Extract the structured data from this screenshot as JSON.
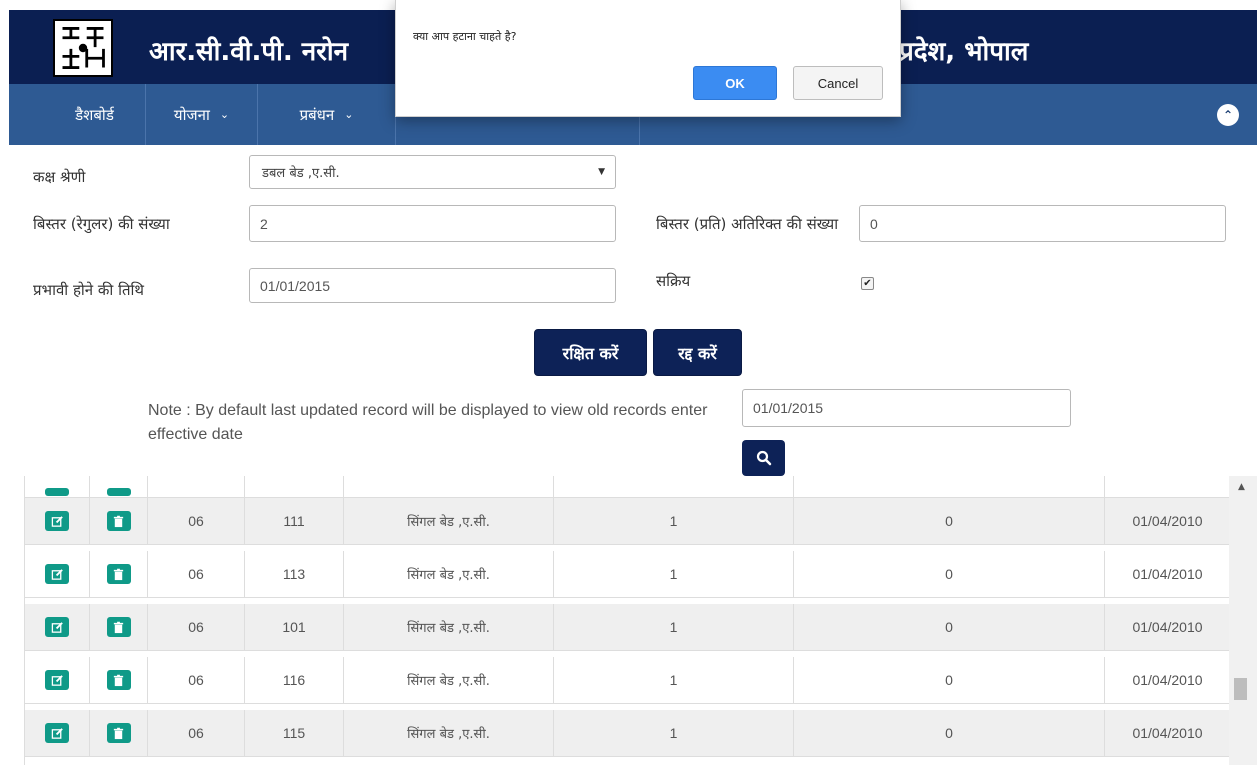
{
  "header": {
    "title_left": "आर.सी.वी.पी. नरोन",
    "title_right": "प्रदेश, भोपाल"
  },
  "nav": {
    "items": [
      {
        "label": "डैशबोर्ड"
      },
      {
        "label": "योजना"
      },
      {
        "label": "प्रबंधन"
      }
    ],
    "collapse_icon": "chevron-up-circle-icon"
  },
  "form": {
    "room_category_label": "कक्ष श्रेणी",
    "room_category_value": "डबल बेड ,ए.सी.",
    "regular_beds_label": "बिस्तर (रेगुलर) की संख्या",
    "regular_beds_value": "2",
    "extra_beds_label": "बिस्तर (प्रति) अतिरिक्त की संख्या",
    "extra_beds_value": "0",
    "effective_date_label": "प्रभावी होने की तिथि",
    "effective_date_value": "01/01/2015",
    "active_label": "सक्रिय",
    "active_checked": true,
    "save_label": "रक्षित करें",
    "cancel_label": "रद्द करें"
  },
  "search": {
    "note": "Note : By default last updated record will be displayed to view old records enter effective date",
    "date_value": "01/01/2015",
    "icon": "search-icon"
  },
  "table": {
    "rows": [
      {
        "code": "06",
        "room": "111",
        "type": "सिंगल बेड ,ए.सी.",
        "regular": "1",
        "extra": "0",
        "date": "01/04/2010"
      },
      {
        "code": "06",
        "room": "113",
        "type": "सिंगल बेड ,ए.सी.",
        "regular": "1",
        "extra": "0",
        "date": "01/04/2010"
      },
      {
        "code": "06",
        "room": "101",
        "type": "सिंगल बेड ,ए.सी.",
        "regular": "1",
        "extra": "0",
        "date": "01/04/2010"
      },
      {
        "code": "06",
        "room": "116",
        "type": "सिंगल बेड ,ए.सी.",
        "regular": "1",
        "extra": "0",
        "date": "01/04/2010"
      },
      {
        "code": "06",
        "room": "115",
        "type": "सिंगल बेड ,ए.सी.",
        "regular": "1",
        "extra": "0",
        "date": "01/04/2010"
      }
    ]
  },
  "dialog": {
    "message": "क्या आप हटाना चाहते है?",
    "ok_label": "OK",
    "cancel_label": "Cancel"
  },
  "colors": {
    "header_bg": "#0b1f52",
    "nav_bg": "#2e5a93",
    "primary_button": "#0d2257",
    "icon_button": "#0f9a88",
    "dialog_ok": "#3b8cf2"
  }
}
